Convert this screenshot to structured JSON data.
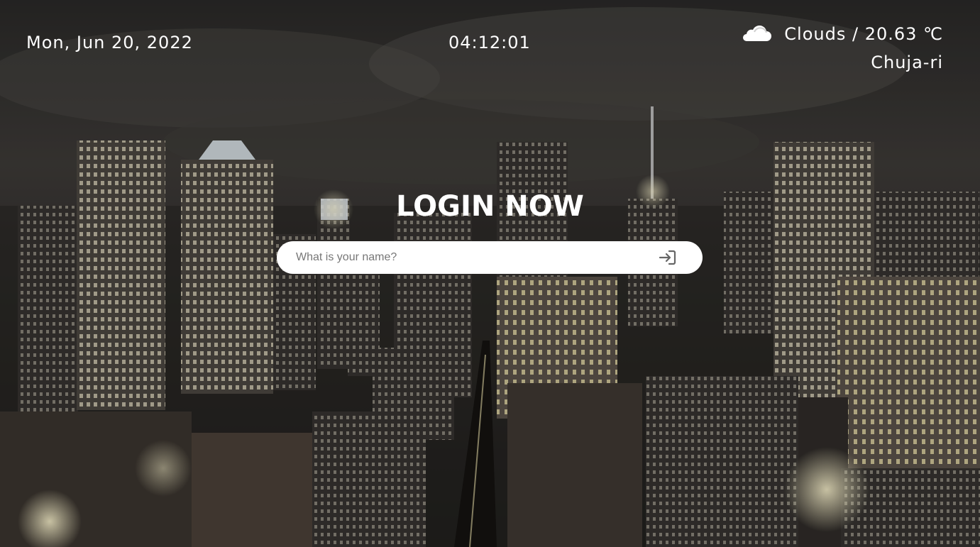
{
  "header": {
    "date": "Mon, Jun 20, 2022",
    "time": "04:12:01"
  },
  "weather": {
    "icon": "cloud-icon",
    "summary": "Clouds / 20.63 ℃",
    "city": "Chuja-ri"
  },
  "login": {
    "title": "LOGIN NOW",
    "placeholder": "What is your name?",
    "submit_icon": "sign-in-icon"
  },
  "colors": {
    "text": "#ffffff",
    "input_bg": "#ffffff",
    "icon": "#666666"
  }
}
